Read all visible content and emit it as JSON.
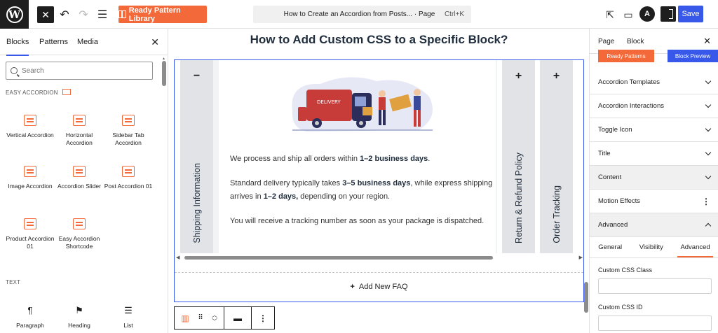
{
  "topbar": {
    "ready_pattern_label": "Ready Pattern Library",
    "command_title": "How to Create an Accordion from Posts... · Page",
    "command_shortcut": "Ctrl+K",
    "save_label": "Save",
    "astra_label": "A"
  },
  "inserter": {
    "tabs": [
      "Blocks",
      "Patterns",
      "Media"
    ],
    "search_placeholder": "Search",
    "category_easy": "EASY ACCORDION",
    "easy_blocks": [
      "Vertical Accordion",
      "Horizontal Accordion",
      "Sidebar Tab Accordion",
      "Image Accordion",
      "Accordion Slider",
      "Post Accordion 01",
      "Product Accordion 01",
      "Easy Accordion Shortcode"
    ],
    "category_text": "TEXT",
    "text_blocks": [
      "Paragraph",
      "Heading",
      "List"
    ]
  },
  "canvas": {
    "heading": "How to Add Custom CSS to a Specific Block?",
    "accordion": {
      "open_tab": {
        "symbol": "−",
        "label": "Shipping Information"
      },
      "closed_tabs": [
        {
          "symbol": "+",
          "label": "Return & Refund Policy"
        },
        {
          "symbol": "+",
          "label": "Order Tracking"
        }
      ],
      "illustration_label": "DELIVERY",
      "p1_a": "We process and ship all orders within ",
      "p1_b": "1–2 business days",
      "p1_c": ".",
      "p2_a": "Standard delivery typically takes ",
      "p2_b": "3–5 business days",
      "p2_c": ", while express shipping arrives in ",
      "p2_d": "1–2 days,",
      "p2_e": " depending on your region.",
      "p3": "You will receive a tracking number as soon as your package is dispatched.",
      "add_faq": "Add New FAQ"
    }
  },
  "sidebar": {
    "tabs": [
      "Page",
      "Block"
    ],
    "peek_left": "Ready Patterns",
    "peek_right": "Block Preview",
    "panels": [
      "Accordion Templates",
      "Accordion Interactions",
      "Toggle Icon",
      "Title",
      "Content",
      "Motion Effects",
      "Advanced"
    ],
    "advanced_tabs": [
      "General",
      "Visibility",
      "Advanced"
    ],
    "css_class_label": "Custom CSS Class",
    "css_id_label": "Custom CSS ID"
  },
  "colors": {
    "accent_orange": "#f4693a",
    "wp_blue": "#3858e9",
    "dark": "#1e1e1e"
  }
}
